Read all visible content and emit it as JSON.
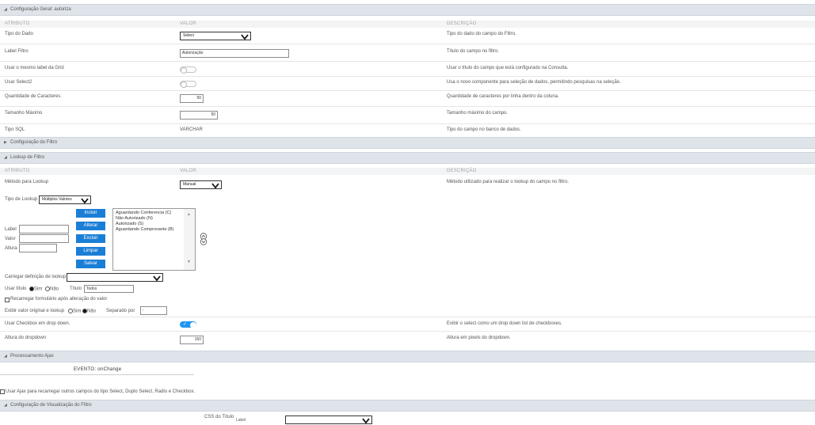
{
  "section_general": {
    "title": "Configuração Geral: autoriza",
    "columns": {
      "attr": "ATRIBUTO",
      "value": "VALOR",
      "desc": "DESCRIÇÃO"
    },
    "rows": {
      "tipo_dado": {
        "label": "Tipo do Dado",
        "value": "Select",
        "desc": "Tipo do dado do campo do Filtro."
      },
      "label_filtro": {
        "label": "Label Filtro",
        "value": "Autorização",
        "desc": "Título do campo no filtro."
      },
      "usar_label_grid": {
        "label": "Usar o mesmo label da Grid",
        "on": false,
        "desc": "Usar o título do campo que está configurado na Consulta."
      },
      "usar_select2": {
        "label": "Usar Select2",
        "on": false,
        "desc": "Usa o novo componente para seleção de dados, permitindo pesquisas na seleção."
      },
      "qtd_caracteres": {
        "label": "Quantidade de Caracteres",
        "value": "50",
        "desc": "Quantidade de caracteres por linha dentro da coluna."
      },
      "tamanho_maximo": {
        "label": "Tamanho Máximo",
        "value": "50",
        "desc": "Tamanho máximo do campo."
      },
      "tipo_sql": {
        "label": "Tipo SQL",
        "value": "VARCHAR",
        "desc": "Tipo do campo no banco de dados."
      }
    }
  },
  "section_config_filtro": {
    "title": "Configuração do Filtro"
  },
  "section_lookup": {
    "title": "Lookup de Filtro",
    "columns": {
      "attr": "ATRIBUTO",
      "value": "VALOR",
      "desc": "DESCRIÇÃO"
    },
    "metodo": {
      "label": "Método para Lookup",
      "value": "Manual",
      "desc": "Método utilizado para realizar o lookup do campo no filtro."
    },
    "tipo_lookup": {
      "label": "Tipo de Lookup",
      "value": "Múltiplos Valores"
    },
    "fields": {
      "label": "Label",
      "valor": "Valor",
      "altura": "Altura"
    },
    "buttons": {
      "incluir": "Incluir",
      "alterar": "Alterar",
      "excluir": "Excluir",
      "limpar": "Limpar",
      "salvar": "Salvar"
    },
    "list_items": [
      "Aguardando Conferencia (C)",
      "Não Autorizado (N)",
      "Autorizado (S)",
      "Aguardando Comprovante (B)"
    ],
    "carregar": {
      "label": "Carregar definição de lookup",
      "value": ""
    },
    "usar_titulo": {
      "label": "Usar título",
      "sim": "Sim",
      "nao": "Não",
      "titulo_label": "Título",
      "titulo_value": "Todos"
    },
    "recarregar": {
      "label": "Recarregar formulário após alteração do valor"
    },
    "exibir_original": {
      "label": "Exibir valor original e lookup",
      "sim": "Sim",
      "nao": "Não",
      "separador_label": "Separado por",
      "separador_value": "-"
    },
    "checkbox_dropdown": {
      "label": "Usar Checkbox em drop down.",
      "on": true,
      "desc": "Exibir o select como um drop down list de checkboxes."
    },
    "altura_dropdown": {
      "label": "Altura do dropdown",
      "value": "150",
      "desc": "Altura em pixels do dropdown."
    }
  },
  "section_ajax": {
    "title": "Processamento Ajax",
    "evento": "EVENTO: onChange",
    "checkbox_label": "Usar Ajax para recarregar outros campos do tipo Select, Duplo Select, Radio e Checkbox."
  },
  "section_visual": {
    "title": "Configuração de Visualização do Filtro",
    "css_label": "CSS do Título",
    "css_sub": "Label"
  }
}
